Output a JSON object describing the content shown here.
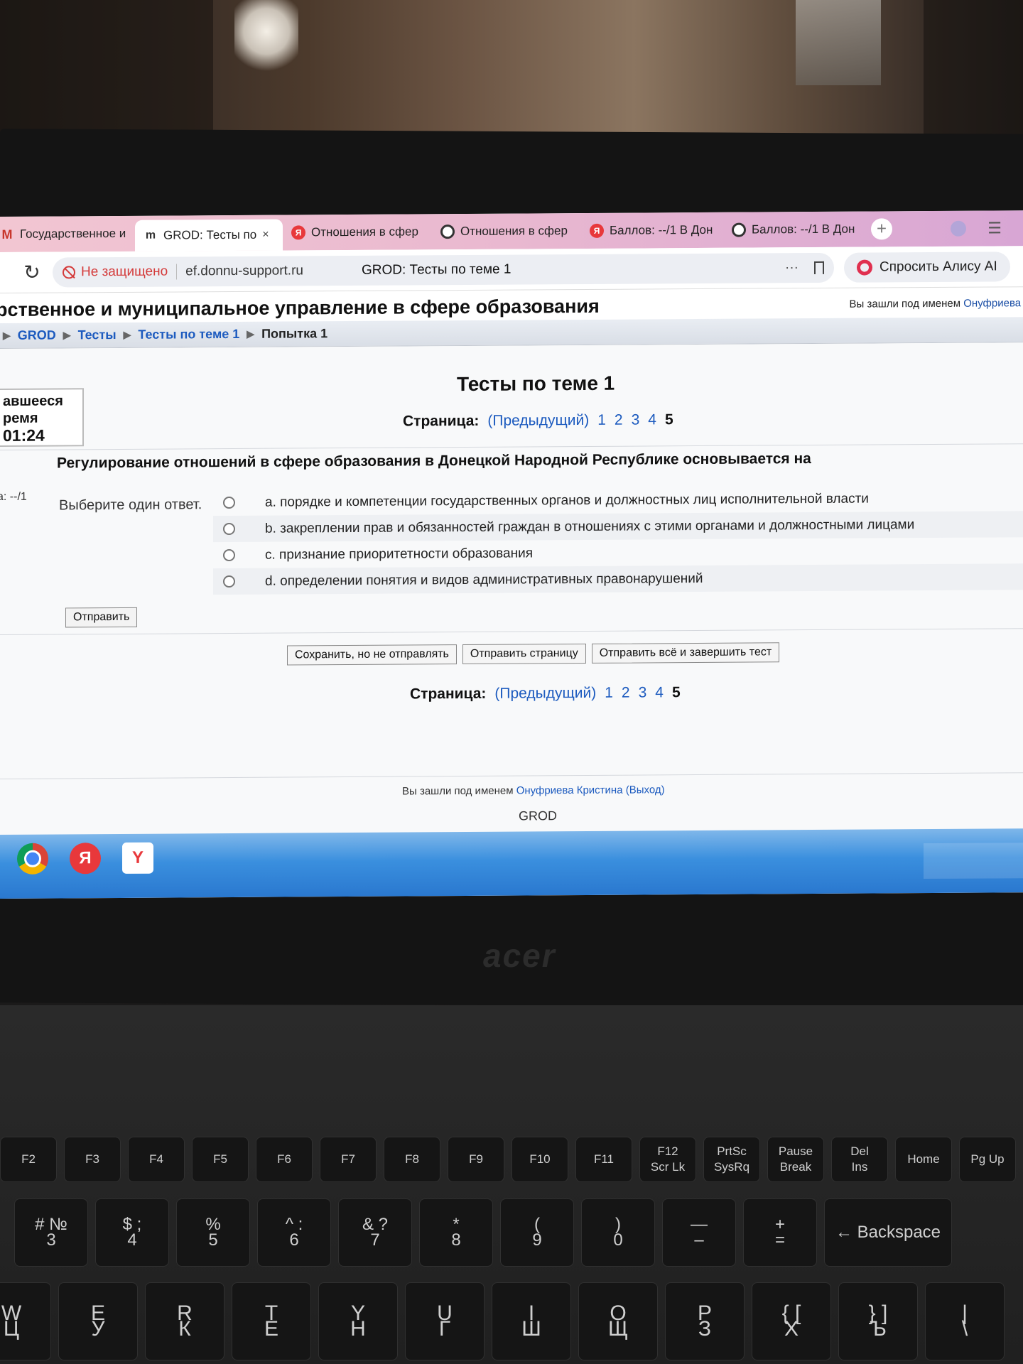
{
  "tabs": [
    {
      "label": "Государственное и",
      "icon": "gmail-icon"
    },
    {
      "label": "GROD: Тесты по",
      "icon": "moodle-icon",
      "active": true
    },
    {
      "label": "Отношения в сфер",
      "icon": "yandex-icon"
    },
    {
      "label": "Отношения в сфер",
      "icon": "alice-ring-icon"
    },
    {
      "label": "Баллов: --/1 В Дон",
      "icon": "yandex-icon"
    },
    {
      "label": "Баллов: --/1 В Дон",
      "icon": "alice-ring-icon"
    }
  ],
  "tab_close": "×",
  "new_tab": "+",
  "address": {
    "security": "Не защищено",
    "host": "ef.donnu-support.ru",
    "page_title": "GROD: Тесты по теме 1",
    "more": "···",
    "alice": "Спросить Алису AI"
  },
  "header": {
    "course_title": "рственное и муниципальное управление в сфере образования",
    "logged_prefix": "Вы зашли под именем ",
    "logged_user": "Онуфриева К"
  },
  "breadcrumb": {
    "lead": "▶",
    "items": [
      "GROD",
      "Тесты",
      "Тесты по теме 1"
    ],
    "current": "Попытка 1"
  },
  "timer": {
    "line1": "авшееся",
    "line2": "ремя",
    "value": "01:24"
  },
  "quiz": {
    "title": "Тесты по теме 1",
    "page_label": "Страница:",
    "prev": "(Предыдущий)",
    "pages": [
      "1",
      "2",
      "3",
      "4"
    ],
    "current_page": "5",
    "question": "Регулирование отношений в сфере образования в Донецкой Народной Республике основывается на",
    "mark": "а: --/1",
    "choose": "Выберите один ответ.",
    "answers": [
      "a. порядке и компетенции государственных органов и должностных лиц исполнительной власти",
      "b. закреплении прав и обязанностей граждан в отношениях с этими органами и должностными лицами",
      "c. признание приоритетности образования",
      "d. определении понятия и видов административных правонарушений"
    ],
    "submit_label": "Отправить",
    "buttons": {
      "save": "Сохранить, но не отправлять",
      "submit_page": "Отправить страницу",
      "submit_all": "Отправить всё и завершить тест"
    }
  },
  "footer": {
    "logged_prefix": "Вы зашли под именем ",
    "user": "Онуфриева Кристина",
    "logout": "(Выход)",
    "site": "GROD"
  },
  "taskbar": {
    "icons": [
      "chrome-icon",
      "yandex-icon",
      "yandex-browser-icon"
    ]
  },
  "laptop": {
    "brand": "acer"
  },
  "keyboard": {
    "fn_row": [
      "F2",
      "F3",
      "F4",
      "F5",
      "F6",
      "F7",
      "F8",
      "F9",
      "F10",
      "F11",
      "F12\nScr Lk",
      "PrtSc\nSysRq",
      "Pause\nBreak",
      "Del\nIns",
      "Home",
      "Pg Up"
    ],
    "num_row": [
      "# №\n3",
      "$ ;\n4",
      "%\n5",
      "^ :\n6",
      "& ?\n7",
      "*\n8",
      "(\n9",
      ")\n0",
      "—\n–",
      "+\n=",
      "← Backspace"
    ],
    "letter_row": [
      "W\nЦ",
      "E\nУ",
      "R\nК",
      "T\nЕ",
      "Y\nН",
      "U\nГ",
      "I\nШ",
      "O\nЩ",
      "P\nЗ",
      "{ [\nХ",
      "} ]\nЪ",
      "|\n\\"
    ]
  }
}
